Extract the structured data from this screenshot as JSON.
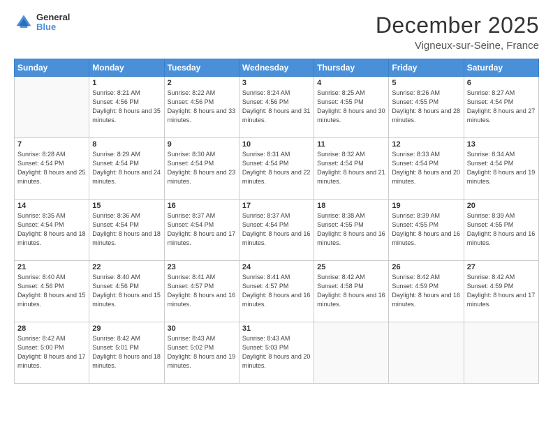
{
  "header": {
    "logo_general": "General",
    "logo_blue": "Blue",
    "title": "December 2025",
    "subtitle": "Vigneux-sur-Seine, France"
  },
  "calendar": {
    "days_header": [
      "Sunday",
      "Monday",
      "Tuesday",
      "Wednesday",
      "Thursday",
      "Friday",
      "Saturday"
    ],
    "weeks": [
      [
        {
          "num": "",
          "info": ""
        },
        {
          "num": "1",
          "info": "Sunrise: 8:21 AM\nSunset: 4:56 PM\nDaylight: 8 hours\nand 35 minutes."
        },
        {
          "num": "2",
          "info": "Sunrise: 8:22 AM\nSunset: 4:56 PM\nDaylight: 8 hours\nand 33 minutes."
        },
        {
          "num": "3",
          "info": "Sunrise: 8:24 AM\nSunset: 4:56 PM\nDaylight: 8 hours\nand 31 minutes."
        },
        {
          "num": "4",
          "info": "Sunrise: 8:25 AM\nSunset: 4:55 PM\nDaylight: 8 hours\nand 30 minutes."
        },
        {
          "num": "5",
          "info": "Sunrise: 8:26 AM\nSunset: 4:55 PM\nDaylight: 8 hours\nand 28 minutes."
        },
        {
          "num": "6",
          "info": "Sunrise: 8:27 AM\nSunset: 4:54 PM\nDaylight: 8 hours\nand 27 minutes."
        }
      ],
      [
        {
          "num": "7",
          "info": "Sunrise: 8:28 AM\nSunset: 4:54 PM\nDaylight: 8 hours\nand 25 minutes."
        },
        {
          "num": "8",
          "info": "Sunrise: 8:29 AM\nSunset: 4:54 PM\nDaylight: 8 hours\nand 24 minutes."
        },
        {
          "num": "9",
          "info": "Sunrise: 8:30 AM\nSunset: 4:54 PM\nDaylight: 8 hours\nand 23 minutes."
        },
        {
          "num": "10",
          "info": "Sunrise: 8:31 AM\nSunset: 4:54 PM\nDaylight: 8 hours\nand 22 minutes."
        },
        {
          "num": "11",
          "info": "Sunrise: 8:32 AM\nSunset: 4:54 PM\nDaylight: 8 hours\nand 21 minutes."
        },
        {
          "num": "12",
          "info": "Sunrise: 8:33 AM\nSunset: 4:54 PM\nDaylight: 8 hours\nand 20 minutes."
        },
        {
          "num": "13",
          "info": "Sunrise: 8:34 AM\nSunset: 4:54 PM\nDaylight: 8 hours\nand 19 minutes."
        }
      ],
      [
        {
          "num": "14",
          "info": "Sunrise: 8:35 AM\nSunset: 4:54 PM\nDaylight: 8 hours\nand 18 minutes."
        },
        {
          "num": "15",
          "info": "Sunrise: 8:36 AM\nSunset: 4:54 PM\nDaylight: 8 hours\nand 18 minutes."
        },
        {
          "num": "16",
          "info": "Sunrise: 8:37 AM\nSunset: 4:54 PM\nDaylight: 8 hours\nand 17 minutes."
        },
        {
          "num": "17",
          "info": "Sunrise: 8:37 AM\nSunset: 4:54 PM\nDaylight: 8 hours\nand 16 minutes."
        },
        {
          "num": "18",
          "info": "Sunrise: 8:38 AM\nSunset: 4:55 PM\nDaylight: 8 hours\nand 16 minutes."
        },
        {
          "num": "19",
          "info": "Sunrise: 8:39 AM\nSunset: 4:55 PM\nDaylight: 8 hours\nand 16 minutes."
        },
        {
          "num": "20",
          "info": "Sunrise: 8:39 AM\nSunset: 4:55 PM\nDaylight: 8 hours\nand 16 minutes."
        }
      ],
      [
        {
          "num": "21",
          "info": "Sunrise: 8:40 AM\nSunset: 4:56 PM\nDaylight: 8 hours\nand 15 minutes."
        },
        {
          "num": "22",
          "info": "Sunrise: 8:40 AM\nSunset: 4:56 PM\nDaylight: 8 hours\nand 15 minutes."
        },
        {
          "num": "23",
          "info": "Sunrise: 8:41 AM\nSunset: 4:57 PM\nDaylight: 8 hours\nand 16 minutes."
        },
        {
          "num": "24",
          "info": "Sunrise: 8:41 AM\nSunset: 4:57 PM\nDaylight: 8 hours\nand 16 minutes."
        },
        {
          "num": "25",
          "info": "Sunrise: 8:42 AM\nSunset: 4:58 PM\nDaylight: 8 hours\nand 16 minutes."
        },
        {
          "num": "26",
          "info": "Sunrise: 8:42 AM\nSunset: 4:59 PM\nDaylight: 8 hours\nand 16 minutes."
        },
        {
          "num": "27",
          "info": "Sunrise: 8:42 AM\nSunset: 4:59 PM\nDaylight: 8 hours\nand 17 minutes."
        }
      ],
      [
        {
          "num": "28",
          "info": "Sunrise: 8:42 AM\nSunset: 5:00 PM\nDaylight: 8 hours\nand 17 minutes."
        },
        {
          "num": "29",
          "info": "Sunrise: 8:42 AM\nSunset: 5:01 PM\nDaylight: 8 hours\nand 18 minutes."
        },
        {
          "num": "30",
          "info": "Sunrise: 8:43 AM\nSunset: 5:02 PM\nDaylight: 8 hours\nand 19 minutes."
        },
        {
          "num": "31",
          "info": "Sunrise: 8:43 AM\nSunset: 5:03 PM\nDaylight: 8 hours\nand 20 minutes."
        },
        {
          "num": "",
          "info": ""
        },
        {
          "num": "",
          "info": ""
        },
        {
          "num": "",
          "info": ""
        }
      ]
    ]
  }
}
